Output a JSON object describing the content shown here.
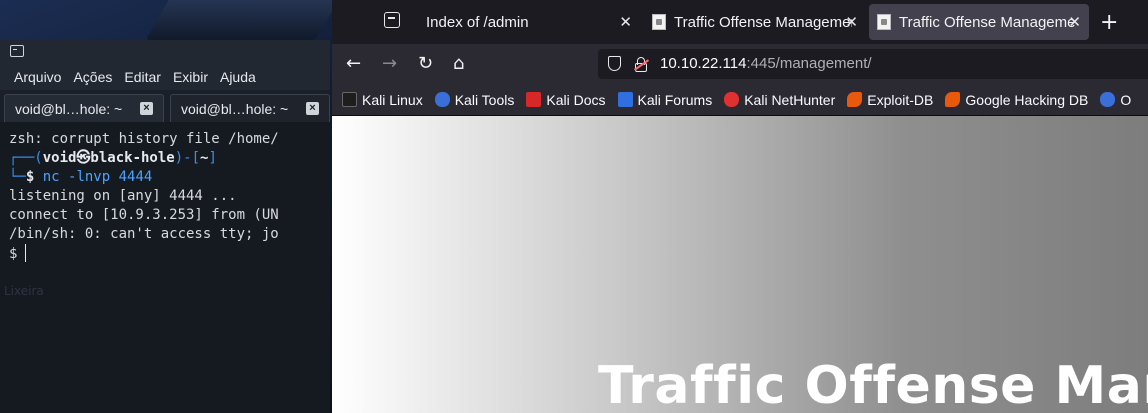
{
  "terminal": {
    "menu": [
      "Arquivo",
      "Ações",
      "Editar",
      "Exibir",
      "Ajuda"
    ],
    "tabs": [
      {
        "label": "void@bl…hole: ~"
      },
      {
        "label": "void@bl…hole: ~"
      }
    ],
    "lines": {
      "l1": "zsh: corrupt history file /home/",
      "prompt_corner": "┌──(",
      "prompt_user": "void㉿black-hole",
      "prompt_mid": ")-[",
      "prompt_dir": "~",
      "prompt_end": "]",
      "prompt2_corner": "└─",
      "prompt2_sym": "$",
      "command": "nc -lnvp 4444",
      "l4": "listening on [any] 4444 ...",
      "l5": "connect to [10.9.3.253] from (UN",
      "l6": "/bin/sh: 0: can't access tty; jo",
      "shell_prompt": "$"
    },
    "ghost_text": "Lixeira"
  },
  "browser": {
    "tabs": [
      {
        "label": "Index of /admin",
        "close": "✕"
      },
      {
        "label": "Traffic Offense Management",
        "close": "✕"
      },
      {
        "label": "Traffic Offense Management",
        "close": "✕"
      }
    ],
    "new_tab": "+",
    "url": {
      "host": "10.10.22.114",
      "rest": ":445/management/"
    },
    "bookmarks": [
      {
        "label": "Kali Linux",
        "color": "#1e1e1e"
      },
      {
        "label": "Kali Tools",
        "color": "#3b6fd8"
      },
      {
        "label": "Kali Docs",
        "color": "#d62828"
      },
      {
        "label": "Kali Forums",
        "color": "#2f6fe0"
      },
      {
        "label": "Kali NetHunter",
        "color": "#e03131"
      },
      {
        "label": "Exploit-DB",
        "color": "#e8590c"
      },
      {
        "label": "Google Hacking DB",
        "color": "#e8590c"
      },
      {
        "label": "O",
        "color": "#3b6fd8"
      }
    ],
    "page_heading": "Traffic Offense Management"
  }
}
